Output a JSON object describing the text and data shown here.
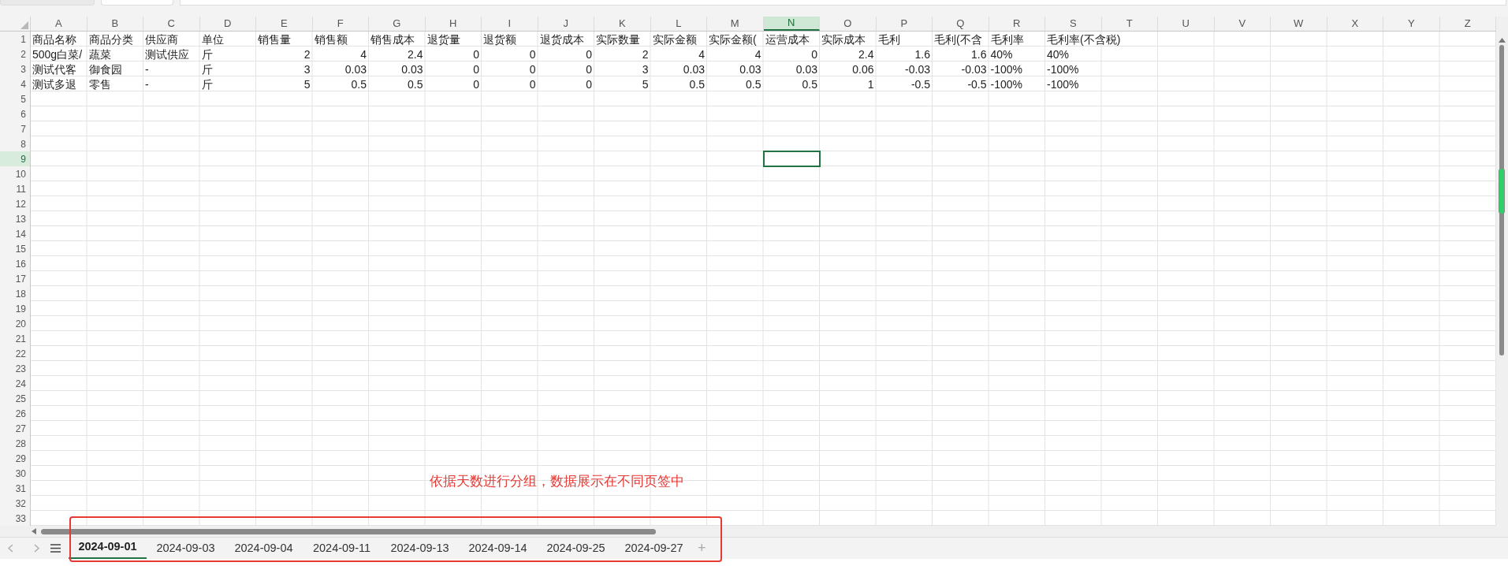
{
  "columns": [
    {
      "label": "A",
      "kind": "text",
      "selected": false
    },
    {
      "label": "B",
      "kind": "text",
      "selected": false
    },
    {
      "label": "C",
      "kind": "text",
      "selected": false
    },
    {
      "label": "D",
      "kind": "text",
      "selected": false
    },
    {
      "label": "E",
      "kind": "number",
      "selected": false
    },
    {
      "label": "F",
      "kind": "number",
      "selected": false
    },
    {
      "label": "G",
      "kind": "number",
      "selected": false
    },
    {
      "label": "H",
      "kind": "number",
      "selected": false
    },
    {
      "label": "I",
      "kind": "number",
      "selected": false
    },
    {
      "label": "J",
      "kind": "number",
      "selected": false
    },
    {
      "label": "K",
      "kind": "number",
      "selected": false
    },
    {
      "label": "L",
      "kind": "number",
      "selected": false
    },
    {
      "label": "M",
      "kind": "number",
      "selected": false
    },
    {
      "label": "N",
      "kind": "number",
      "selected": true
    },
    {
      "label": "O",
      "kind": "number",
      "selected": false
    },
    {
      "label": "P",
      "kind": "number",
      "selected": false
    },
    {
      "label": "Q",
      "kind": "number",
      "selected": false
    },
    {
      "label": "R",
      "kind": "text",
      "selected": false
    },
    {
      "label": "S",
      "kind": "text",
      "selected": false
    },
    {
      "label": "T",
      "kind": "text",
      "selected": false
    },
    {
      "label": "U",
      "kind": "text",
      "selected": false
    },
    {
      "label": "V",
      "kind": "text",
      "selected": false
    },
    {
      "label": "W",
      "kind": "text",
      "selected": false
    },
    {
      "label": "X",
      "kind": "text",
      "selected": false
    },
    {
      "label": "Y",
      "kind": "text",
      "selected": false
    },
    {
      "label": "Z",
      "kind": "text",
      "selected": false
    }
  ],
  "rows": [
    {
      "number": "1",
      "selected": false,
      "kind": "header",
      "cells": [
        "商品名称",
        "商品分类",
        "供应商",
        "单位",
        "销售量",
        "销售额",
        "销售成本",
        "退货量",
        "退货额",
        "退货成本",
        "实际数量",
        "实际金额",
        "实际金额(",
        "运营成本",
        "实际成本",
        "毛利",
        "毛利(不含",
        "毛利率",
        "毛利率(不含税)"
      ]
    },
    {
      "number": "2",
      "selected": false,
      "kind": "data",
      "cells": [
        "500g白菜/",
        "蔬菜",
        "测试供应",
        "斤",
        "2",
        "4",
        "2.4",
        "0",
        "0",
        "0",
        "2",
        "4",
        "4",
        "0",
        "2.4",
        "1.6",
        "1.6",
        "40%",
        "40%"
      ]
    },
    {
      "number": "3",
      "selected": false,
      "kind": "data",
      "cells": [
        "测试代客",
        "御食园",
        "-",
        "斤",
        "3",
        "0.03",
        "0.03",
        "0",
        "0",
        "0",
        "3",
        "0.03",
        "0.03",
        "0.03",
        "0.06",
        "-0.03",
        "-0.03",
        "-100%",
        "-100%"
      ]
    },
    {
      "number": "4",
      "selected": false,
      "kind": "data",
      "cells": [
        "测试多退",
        "零售",
        "-",
        "斤",
        "5",
        "0.5",
        "0.5",
        "0",
        "0",
        "0",
        "5",
        "0.5",
        "0.5",
        "0.5",
        "1",
        "-0.5",
        "-0.5",
        "-100%",
        "-100%"
      ]
    },
    {
      "number": "5",
      "selected": false
    },
    {
      "number": "6",
      "selected": false
    },
    {
      "number": "7",
      "selected": false
    },
    {
      "number": "8",
      "selected": false
    },
    {
      "number": "9",
      "selected": true
    },
    {
      "number": "10",
      "selected": false
    },
    {
      "number": "11",
      "selected": false
    },
    {
      "number": "12",
      "selected": false
    },
    {
      "number": "13",
      "selected": false
    },
    {
      "number": "14",
      "selected": false
    },
    {
      "number": "15",
      "selected": false
    },
    {
      "number": "16",
      "selected": false
    },
    {
      "number": "17",
      "selected": false
    },
    {
      "number": "18",
      "selected": false
    },
    {
      "number": "19",
      "selected": false
    },
    {
      "number": "20",
      "selected": false
    },
    {
      "number": "21",
      "selected": false
    },
    {
      "number": "22",
      "selected": false
    },
    {
      "number": "23",
      "selected": false
    },
    {
      "number": "24",
      "selected": false
    },
    {
      "number": "25",
      "selected": false
    },
    {
      "number": "26",
      "selected": false
    },
    {
      "number": "27",
      "selected": false
    },
    {
      "number": "28",
      "selected": false
    },
    {
      "number": "29",
      "selected": false
    },
    {
      "number": "30",
      "selected": false
    },
    {
      "number": "31",
      "selected": false
    },
    {
      "number": "32",
      "selected": false
    },
    {
      "number": "33",
      "selected": false
    }
  ],
  "sheet_tabs": [
    {
      "label": "2024-09-01",
      "selected": true
    },
    {
      "label": "2024-09-03",
      "selected": false
    },
    {
      "label": "2024-09-04",
      "selected": false
    },
    {
      "label": "2024-09-11",
      "selected": false
    },
    {
      "label": "2024-09-13",
      "selected": false
    },
    {
      "label": "2024-09-14",
      "selected": false
    },
    {
      "label": "2024-09-25",
      "selected": false
    },
    {
      "label": "2024-09-27",
      "selected": false
    }
  ],
  "add_sheet": "+",
  "annotation": {
    "text": "依据天数进行分组，数据展示在不同页签中"
  }
}
